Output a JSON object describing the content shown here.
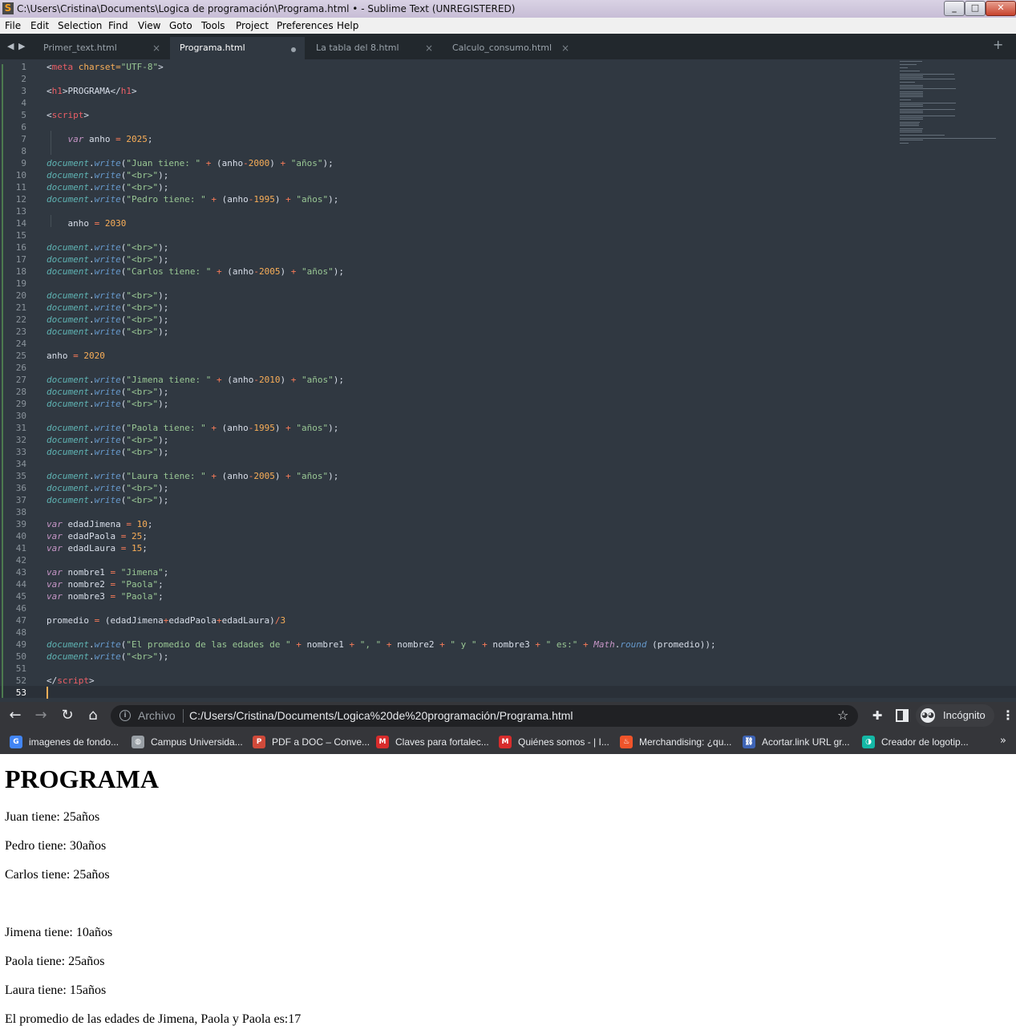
{
  "sublime": {
    "window_title": "C:\\Users\\Cristina\\Documents\\Logica de programación\\Programa.html • - Sublime Text (UNREGISTERED)",
    "menu": [
      "File",
      "Edit",
      "Selection",
      "Find",
      "View",
      "Goto",
      "Tools",
      "Project",
      "Preferences",
      "Help"
    ],
    "tabs": [
      {
        "label": "Primer_text.html",
        "active": false,
        "dirty": false
      },
      {
        "label": "Programa.html",
        "active": true,
        "dirty": true
      },
      {
        "label": "La tabla del 8.html",
        "active": false,
        "dirty": false
      },
      {
        "label": "Calculo_consumo.html",
        "active": false,
        "dirty": false
      }
    ],
    "current_line": 53,
    "code": [
      [
        [
          "<",
          "#d8dee9"
        ],
        [
          "meta",
          "#ec5f66"
        ],
        [
          " charset=",
          "#f9ae58"
        ],
        [
          "\"UTF-8\"",
          "#99c794"
        ],
        [
          ">",
          "#d8dee9"
        ]
      ],
      [],
      [
        [
          "<",
          "#d8dee9"
        ],
        [
          "h1",
          "#ec5f66"
        ],
        [
          ">PROGRAMA</",
          "#d8dee9"
        ],
        [
          "h1",
          "#ec5f66"
        ],
        [
          ">",
          "#d8dee9"
        ]
      ],
      [],
      [
        [
          "<",
          "#d8dee9"
        ],
        [
          "script",
          "#ec5f66"
        ],
        [
          ">",
          "#d8dee9"
        ]
      ],
      [],
      [
        [
          "    ",
          "#d8dee9"
        ],
        [
          "var",
          "#c695c6"
        ],
        [
          " anho ",
          "#d8dee9"
        ],
        [
          "=",
          "#f97b58"
        ],
        [
          " ",
          "#d8dee9"
        ],
        [
          "2025",
          "#f9ae58"
        ],
        [
          ";",
          "#d8dee9"
        ]
      ],
      [],
      [
        [
          "document",
          "#5fb4b4"
        ],
        [
          ".",
          "#d8dee9"
        ],
        [
          "write",
          "#6699cc"
        ],
        [
          "(",
          "#d8dee9"
        ],
        [
          "\"Juan tiene: \"",
          "#99c794"
        ],
        [
          " ",
          "#d8dee9"
        ],
        [
          "+",
          "#f97b58"
        ],
        [
          " (anho",
          "#d8dee9"
        ],
        [
          "-",
          "#f97b58"
        ],
        [
          "2000",
          "#f9ae58"
        ],
        [
          ") ",
          "#d8dee9"
        ],
        [
          "+",
          "#f97b58"
        ],
        [
          " ",
          "#d8dee9"
        ],
        [
          "\"años\"",
          "#99c794"
        ],
        [
          ");",
          "#d8dee9"
        ]
      ],
      [
        [
          "document",
          "#5fb4b4"
        ],
        [
          ".",
          "#d8dee9"
        ],
        [
          "write",
          "#6699cc"
        ],
        [
          "(",
          "#d8dee9"
        ],
        [
          "\"<br>\"",
          "#99c794"
        ],
        [
          ");",
          "#d8dee9"
        ]
      ],
      [
        [
          "document",
          "#5fb4b4"
        ],
        [
          ".",
          "#d8dee9"
        ],
        [
          "write",
          "#6699cc"
        ],
        [
          "(",
          "#d8dee9"
        ],
        [
          "\"<br>\"",
          "#99c794"
        ],
        [
          ");",
          "#d8dee9"
        ]
      ],
      [
        [
          "document",
          "#5fb4b4"
        ],
        [
          ".",
          "#d8dee9"
        ],
        [
          "write",
          "#6699cc"
        ],
        [
          "(",
          "#d8dee9"
        ],
        [
          "\"Pedro tiene: \"",
          "#99c794"
        ],
        [
          " ",
          "#d8dee9"
        ],
        [
          "+",
          "#f97b58"
        ],
        [
          " (anho",
          "#d8dee9"
        ],
        [
          "-",
          "#f97b58"
        ],
        [
          "1995",
          "#f9ae58"
        ],
        [
          ") ",
          "#d8dee9"
        ],
        [
          "+",
          "#f97b58"
        ],
        [
          " ",
          "#d8dee9"
        ],
        [
          "\"años\"",
          "#99c794"
        ],
        [
          ");",
          "#d8dee9"
        ]
      ],
      [],
      [
        [
          "    anho ",
          "#d8dee9"
        ],
        [
          "=",
          "#f97b58"
        ],
        [
          " ",
          "#d8dee9"
        ],
        [
          "2030",
          "#f9ae58"
        ]
      ],
      [],
      [
        [
          "document",
          "#5fb4b4"
        ],
        [
          ".",
          "#d8dee9"
        ],
        [
          "write",
          "#6699cc"
        ],
        [
          "(",
          "#d8dee9"
        ],
        [
          "\"<br>\"",
          "#99c794"
        ],
        [
          ");",
          "#d8dee9"
        ]
      ],
      [
        [
          "document",
          "#5fb4b4"
        ],
        [
          ".",
          "#d8dee9"
        ],
        [
          "write",
          "#6699cc"
        ],
        [
          "(",
          "#d8dee9"
        ],
        [
          "\"<br>\"",
          "#99c794"
        ],
        [
          ");",
          "#d8dee9"
        ]
      ],
      [
        [
          "document",
          "#5fb4b4"
        ],
        [
          ".",
          "#d8dee9"
        ],
        [
          "write",
          "#6699cc"
        ],
        [
          "(",
          "#d8dee9"
        ],
        [
          "\"Carlos tiene: \"",
          "#99c794"
        ],
        [
          " ",
          "#d8dee9"
        ],
        [
          "+",
          "#f97b58"
        ],
        [
          " (anho",
          "#d8dee9"
        ],
        [
          "-",
          "#f97b58"
        ],
        [
          "2005",
          "#f9ae58"
        ],
        [
          ") ",
          "#d8dee9"
        ],
        [
          "+",
          "#f97b58"
        ],
        [
          " ",
          "#d8dee9"
        ],
        [
          "\"años\"",
          "#99c794"
        ],
        [
          ");",
          "#d8dee9"
        ]
      ],
      [],
      [
        [
          "document",
          "#5fb4b4"
        ],
        [
          ".",
          "#d8dee9"
        ],
        [
          "write",
          "#6699cc"
        ],
        [
          "(",
          "#d8dee9"
        ],
        [
          "\"<br>\"",
          "#99c794"
        ],
        [
          ");",
          "#d8dee9"
        ]
      ],
      [
        [
          "document",
          "#5fb4b4"
        ],
        [
          ".",
          "#d8dee9"
        ],
        [
          "write",
          "#6699cc"
        ],
        [
          "(",
          "#d8dee9"
        ],
        [
          "\"<br>\"",
          "#99c794"
        ],
        [
          ");",
          "#d8dee9"
        ]
      ],
      [
        [
          "document",
          "#5fb4b4"
        ],
        [
          ".",
          "#d8dee9"
        ],
        [
          "write",
          "#6699cc"
        ],
        [
          "(",
          "#d8dee9"
        ],
        [
          "\"<br>\"",
          "#99c794"
        ],
        [
          ");",
          "#d8dee9"
        ]
      ],
      [
        [
          "document",
          "#5fb4b4"
        ],
        [
          ".",
          "#d8dee9"
        ],
        [
          "write",
          "#6699cc"
        ],
        [
          "(",
          "#d8dee9"
        ],
        [
          "\"<br>\"",
          "#99c794"
        ],
        [
          ");",
          "#d8dee9"
        ]
      ],
      [],
      [
        [
          "anho ",
          "#d8dee9"
        ],
        [
          "=",
          "#f97b58"
        ],
        [
          " ",
          "#d8dee9"
        ],
        [
          "2020",
          "#f9ae58"
        ]
      ],
      [],
      [
        [
          "document",
          "#5fb4b4"
        ],
        [
          ".",
          "#d8dee9"
        ],
        [
          "write",
          "#6699cc"
        ],
        [
          "(",
          "#d8dee9"
        ],
        [
          "\"Jimena tiene: \"",
          "#99c794"
        ],
        [
          " ",
          "#d8dee9"
        ],
        [
          "+",
          "#f97b58"
        ],
        [
          " (anho",
          "#d8dee9"
        ],
        [
          "-",
          "#f97b58"
        ],
        [
          "2010",
          "#f9ae58"
        ],
        [
          ") ",
          "#d8dee9"
        ],
        [
          "+",
          "#f97b58"
        ],
        [
          " ",
          "#d8dee9"
        ],
        [
          "\"años\"",
          "#99c794"
        ],
        [
          ");",
          "#d8dee9"
        ]
      ],
      [
        [
          "document",
          "#5fb4b4"
        ],
        [
          ".",
          "#d8dee9"
        ],
        [
          "write",
          "#6699cc"
        ],
        [
          "(",
          "#d8dee9"
        ],
        [
          "\"<br>\"",
          "#99c794"
        ],
        [
          ");",
          "#d8dee9"
        ]
      ],
      [
        [
          "document",
          "#5fb4b4"
        ],
        [
          ".",
          "#d8dee9"
        ],
        [
          "write",
          "#6699cc"
        ],
        [
          "(",
          "#d8dee9"
        ],
        [
          "\"<br>\"",
          "#99c794"
        ],
        [
          ");",
          "#d8dee9"
        ]
      ],
      [],
      [
        [
          "document",
          "#5fb4b4"
        ],
        [
          ".",
          "#d8dee9"
        ],
        [
          "write",
          "#6699cc"
        ],
        [
          "(",
          "#d8dee9"
        ],
        [
          "\"Paola tiene: \"",
          "#99c794"
        ],
        [
          " ",
          "#d8dee9"
        ],
        [
          "+",
          "#f97b58"
        ],
        [
          " (anho",
          "#d8dee9"
        ],
        [
          "-",
          "#f97b58"
        ],
        [
          "1995",
          "#f9ae58"
        ],
        [
          ") ",
          "#d8dee9"
        ],
        [
          "+",
          "#f97b58"
        ],
        [
          " ",
          "#d8dee9"
        ],
        [
          "\"años\"",
          "#99c794"
        ],
        [
          ");",
          "#d8dee9"
        ]
      ],
      [
        [
          "document",
          "#5fb4b4"
        ],
        [
          ".",
          "#d8dee9"
        ],
        [
          "write",
          "#6699cc"
        ],
        [
          "(",
          "#d8dee9"
        ],
        [
          "\"<br>\"",
          "#99c794"
        ],
        [
          ");",
          "#d8dee9"
        ]
      ],
      [
        [
          "document",
          "#5fb4b4"
        ],
        [
          ".",
          "#d8dee9"
        ],
        [
          "write",
          "#6699cc"
        ],
        [
          "(",
          "#d8dee9"
        ],
        [
          "\"<br>\"",
          "#99c794"
        ],
        [
          ");",
          "#d8dee9"
        ]
      ],
      [],
      [
        [
          "document",
          "#5fb4b4"
        ],
        [
          ".",
          "#d8dee9"
        ],
        [
          "write",
          "#6699cc"
        ],
        [
          "(",
          "#d8dee9"
        ],
        [
          "\"Laura tiene: \"",
          "#99c794"
        ],
        [
          " ",
          "#d8dee9"
        ],
        [
          "+",
          "#f97b58"
        ],
        [
          " (anho",
          "#d8dee9"
        ],
        [
          "-",
          "#f97b58"
        ],
        [
          "2005",
          "#f9ae58"
        ],
        [
          ") ",
          "#d8dee9"
        ],
        [
          "+",
          "#f97b58"
        ],
        [
          " ",
          "#d8dee9"
        ],
        [
          "\"años\"",
          "#99c794"
        ],
        [
          ");",
          "#d8dee9"
        ]
      ],
      [
        [
          "document",
          "#5fb4b4"
        ],
        [
          ".",
          "#d8dee9"
        ],
        [
          "write",
          "#6699cc"
        ],
        [
          "(",
          "#d8dee9"
        ],
        [
          "\"<br>\"",
          "#99c794"
        ],
        [
          ");",
          "#d8dee9"
        ]
      ],
      [
        [
          "document",
          "#5fb4b4"
        ],
        [
          ".",
          "#d8dee9"
        ],
        [
          "write",
          "#6699cc"
        ],
        [
          "(",
          "#d8dee9"
        ],
        [
          "\"<br>\"",
          "#99c794"
        ],
        [
          ");",
          "#d8dee9"
        ]
      ],
      [],
      [
        [
          "var",
          "#c695c6"
        ],
        [
          " edadJimena ",
          "#d8dee9"
        ],
        [
          "=",
          "#f97b58"
        ],
        [
          " ",
          "#d8dee9"
        ],
        [
          "10",
          "#f9ae58"
        ],
        [
          ";",
          "#d8dee9"
        ]
      ],
      [
        [
          "var",
          "#c695c6"
        ],
        [
          " edadPaola ",
          "#d8dee9"
        ],
        [
          "=",
          "#f97b58"
        ],
        [
          " ",
          "#d8dee9"
        ],
        [
          "25",
          "#f9ae58"
        ],
        [
          ";",
          "#d8dee9"
        ]
      ],
      [
        [
          "var",
          "#c695c6"
        ],
        [
          " edadLaura ",
          "#d8dee9"
        ],
        [
          "=",
          "#f97b58"
        ],
        [
          " ",
          "#d8dee9"
        ],
        [
          "15",
          "#f9ae58"
        ],
        [
          ";",
          "#d8dee9"
        ]
      ],
      [],
      [
        [
          "var",
          "#c695c6"
        ],
        [
          " nombre1 ",
          "#d8dee9"
        ],
        [
          "=",
          "#f97b58"
        ],
        [
          " ",
          "#d8dee9"
        ],
        [
          "\"Jimena\"",
          "#99c794"
        ],
        [
          ";",
          "#d8dee9"
        ]
      ],
      [
        [
          "var",
          "#c695c6"
        ],
        [
          " nombre2 ",
          "#d8dee9"
        ],
        [
          "=",
          "#f97b58"
        ],
        [
          " ",
          "#d8dee9"
        ],
        [
          "\"Paola\"",
          "#99c794"
        ],
        [
          ";",
          "#d8dee9"
        ]
      ],
      [
        [
          "var",
          "#c695c6"
        ],
        [
          " nombre3 ",
          "#d8dee9"
        ],
        [
          "=",
          "#f97b58"
        ],
        [
          " ",
          "#d8dee9"
        ],
        [
          "\"Paola\"",
          "#99c794"
        ],
        [
          ";",
          "#d8dee9"
        ]
      ],
      [],
      [
        [
          "promedio ",
          "#d8dee9"
        ],
        [
          "=",
          "#f97b58"
        ],
        [
          " (edadJimena",
          "#d8dee9"
        ],
        [
          "+",
          "#f97b58"
        ],
        [
          "edadPaola",
          "#d8dee9"
        ],
        [
          "+",
          "#f97b58"
        ],
        [
          "edadLaura)",
          "#d8dee9"
        ],
        [
          "/",
          "#f97b58"
        ],
        [
          "3",
          "#f9ae58"
        ]
      ],
      [],
      [
        [
          "document",
          "#5fb4b4"
        ],
        [
          ".",
          "#d8dee9"
        ],
        [
          "write",
          "#6699cc"
        ],
        [
          "(",
          "#d8dee9"
        ],
        [
          "\"El promedio de las edades de \"",
          "#99c794"
        ],
        [
          " ",
          "#d8dee9"
        ],
        [
          "+",
          "#f97b58"
        ],
        [
          " nombre1 ",
          "#d8dee9"
        ],
        [
          "+",
          "#f97b58"
        ],
        [
          " ",
          "#d8dee9"
        ],
        [
          "\", \"",
          "#99c794"
        ],
        [
          " ",
          "#d8dee9"
        ],
        [
          "+",
          "#f97b58"
        ],
        [
          " nombre2 ",
          "#d8dee9"
        ],
        [
          "+",
          "#f97b58"
        ],
        [
          " ",
          "#d8dee9"
        ],
        [
          "\" y \"",
          "#99c794"
        ],
        [
          " ",
          "#d8dee9"
        ],
        [
          "+",
          "#f97b58"
        ],
        [
          " nombre3 ",
          "#d8dee9"
        ],
        [
          "+",
          "#f97b58"
        ],
        [
          " ",
          "#d8dee9"
        ],
        [
          "\" es:\"",
          "#99c794"
        ],
        [
          " ",
          "#d8dee9"
        ],
        [
          "+",
          "#f97b58"
        ],
        [
          " ",
          "#d8dee9"
        ],
        [
          "Math",
          "#c695c6"
        ],
        [
          ".",
          "#d8dee9"
        ],
        [
          "round",
          "#6699cc"
        ],
        [
          " (promedio));",
          "#d8dee9"
        ]
      ],
      [
        [
          "document",
          "#5fb4b4"
        ],
        [
          ".",
          "#d8dee9"
        ],
        [
          "write",
          "#6699cc"
        ],
        [
          "(",
          "#d8dee9"
        ],
        [
          "\"<br>\"",
          "#99c794"
        ],
        [
          ");",
          "#d8dee9"
        ]
      ],
      [],
      [
        [
          "</",
          "#d8dee9"
        ],
        [
          "script",
          "#ec5f66"
        ],
        [
          ">",
          "#d8dee9"
        ]
      ],
      []
    ]
  },
  "browser": {
    "scheme_label": "Archivo",
    "url": "C:/Users/Cristina/Documents/Logica%20de%20programación/Programa.html",
    "incognito_label": "Incógnito",
    "bookmarks": [
      {
        "label": "imagenes de fondo...",
        "icon": "google-icon",
        "color": "#4285f4"
      },
      {
        "label": "Campus Universida...",
        "icon": "globe-icon",
        "color": "#9aa0a6"
      },
      {
        "label": "PDF a DOC – Conve...",
        "icon": "pdf-doc-icon",
        "color": "#d04a3a"
      },
      {
        "label": "Claves para fortalec...",
        "icon": "m-logo-icon",
        "color": "#d82c2c"
      },
      {
        "label": "Quiénes somos - | I...",
        "icon": "m-logo-icon",
        "color": "#d82c2c"
      },
      {
        "label": "Merchandising: ¿qu...",
        "icon": "flame-icon",
        "color": "#f0542a"
      },
      {
        "label": "Acortar.link URL gr...",
        "icon": "link-shortener-icon",
        "color": "#3e64b6"
      },
      {
        "label": "Creador de logotip...",
        "icon": "logo-maker-icon",
        "color": "#14b8a6"
      }
    ]
  },
  "page": {
    "heading": "PROGRAMA",
    "lines": [
      "Juan tiene: 25años",
      "Pedro tiene: 30años",
      "Carlos tiene: 25años",
      "Jimena tiene: 10años",
      "Paola tiene: 25años",
      "Laura tiene: 15años",
      "El promedio de las edades de Jimena, Paola y Paola es:17"
    ]
  }
}
